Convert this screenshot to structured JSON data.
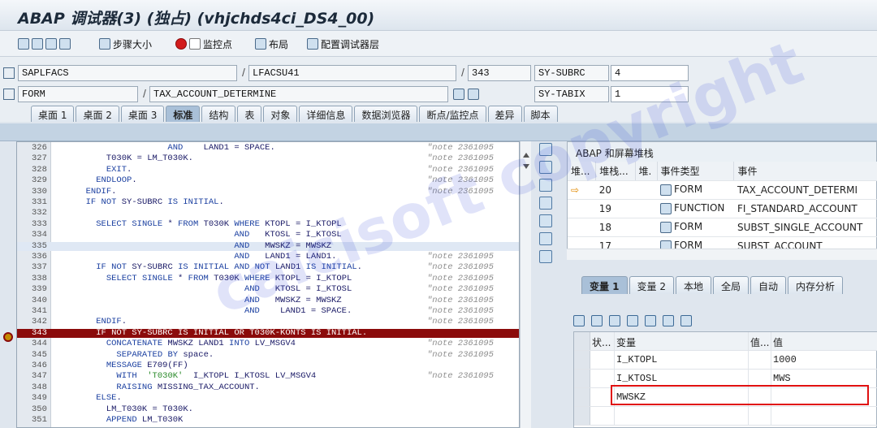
{
  "window": {
    "title": "ABAP 调试器(3) (独占) (vhjchds4ci_DS4_00)"
  },
  "toolbar": {
    "step_size": "步骤大小",
    "watchpoint": "监控点",
    "layout": "布局",
    "configure": "配置调试器层"
  },
  "info": {
    "program": "SAPLFACS",
    "include": "LFACSU41",
    "line": "343",
    "field1_name": "SY-SUBRC",
    "field1_value": "4",
    "event_type": "FORM",
    "event_name": "TAX_ACCOUNT_DETERMINE",
    "field2_name": "SY-TABIX",
    "field2_value": "1"
  },
  "main_tabs": [
    "桌面 1",
    "桌面 2",
    "桌面 3",
    "标准",
    "结构",
    "表",
    "对象",
    "详细信息",
    "数据浏览器",
    "断点/监控点",
    "差异",
    "脚本"
  ],
  "code": {
    "lines": [
      {
        "n": "326",
        "t": "                  AND    LAND1 = SPACE.",
        "c": "\"note 2361095"
      },
      {
        "n": "327",
        "t": "      T030K = LM_T030K.",
        "c": "\"note 2361095"
      },
      {
        "n": "328",
        "t": "      EXIT.",
        "c": "\"note 2361095"
      },
      {
        "n": "329",
        "t": "    ENDLOOP.",
        "c": "\"note 2361095"
      },
      {
        "n": "330",
        "t": "  ENDIF.",
        "c": "\"note 2361095"
      },
      {
        "n": "331",
        "t": "  IF NOT SY-SUBRC IS INITIAL.",
        "c": ""
      },
      {
        "n": "332",
        "t": "",
        "c": ""
      },
      {
        "n": "333",
        "t": "    SELECT SINGLE * FROM T030K WHERE KTOPL = I_KTOPL",
        "c": ""
      },
      {
        "n": "334",
        "t": "                               AND   KTOSL = I_KTOSL",
        "c": ""
      },
      {
        "n": "335",
        "t": "                               AND   MWSKZ = MWSKZ",
        "c": ""
      },
      {
        "n": "336",
        "t": "                               AND   LAND1 = LAND1.",
        "c": "\"note 2361095"
      },
      {
        "n": "337",
        "t": "    IF NOT SY-SUBRC IS INITIAL AND NOT LAND1 IS INITIAL.",
        "c": "\"note 2361095"
      },
      {
        "n": "338",
        "t": "      SELECT SINGLE * FROM T030K WHERE KTOPL = I_KTOPL",
        "c": "\"note 2361095"
      },
      {
        "n": "339",
        "t": "                                 AND   KTOSL = I_KTOSL",
        "c": "\"note 2361095"
      },
      {
        "n": "340",
        "t": "                                 AND   MWSKZ = MWSKZ",
        "c": "\"note 2361095"
      },
      {
        "n": "341",
        "t": "                                 AND    LAND1 = SPACE.",
        "c": "\"note 2361095"
      },
      {
        "n": "342",
        "t": "    ENDIF.",
        "c": "\"note 2361095"
      },
      {
        "n": "343",
        "t": "    IF NOT SY-SUBRC IS INITIAL OR T030K-KONTS IS INITIAL.",
        "c": ""
      },
      {
        "n": "344",
        "t": "      CONCATENATE MWSKZ LAND1 INTO LV_MSGV4",
        "c": "\"note 2361095"
      },
      {
        "n": "345",
        "t": "        SEPARATED BY space.",
        "c": "\"note 2361095"
      },
      {
        "n": "346",
        "t": "      MESSAGE E709(FF)",
        "c": ""
      },
      {
        "n": "347",
        "t": "        WITH  'T030K'  I_KTOPL I_KTOSL LV_MSGV4",
        "c": "\"note 2361095"
      },
      {
        "n": "348",
        "t": "        RAISING MISSING_TAX_ACCOUNT.",
        "c": ""
      },
      {
        "n": "349",
        "t": "    ELSE.",
        "c": ""
      },
      {
        "n": "350",
        "t": "      LM_T030K = T030K.",
        "c": ""
      },
      {
        "n": "351",
        "t": "      APPEND LM_T030K",
        "c": ""
      }
    ]
  },
  "stack": {
    "title": "ABAP 和屏幕堆栈",
    "headers": [
      "堆...",
      "堆栈...",
      "堆.",
      "事件类型",
      "事件"
    ],
    "rows": [
      {
        "level": "20",
        "type": "FORM",
        "event": "TAX_ACCOUNT_DETERMI"
      },
      {
        "level": "19",
        "type": "FUNCTION",
        "event": "FI_STANDARD_ACCOUNT"
      },
      {
        "level": "18",
        "type": "FORM",
        "event": "SUBST_SINGLE_ACCOUNT"
      },
      {
        "level": "17",
        "type": "FORM",
        "event": "SUBST_ACCOUNT"
      }
    ]
  },
  "var_tabs": [
    "变量 1",
    "变量 2",
    "本地",
    "全局",
    "自动",
    "内存分析"
  ],
  "vars": {
    "headers": [
      "状...",
      "变量",
      "值...",
      "值"
    ],
    "rows": [
      {
        "name": "I_KTOPL",
        "value": "1000"
      },
      {
        "name": "I_KTOSL",
        "value": "MWS"
      },
      {
        "name": "MWSKZ",
        "value": ""
      }
    ]
  },
  "watermark": "caicisoft copyright",
  "colors": {
    "highlight": "#8b0b0b",
    "accent": "#a9c0d8",
    "callout": "#e01010"
  }
}
